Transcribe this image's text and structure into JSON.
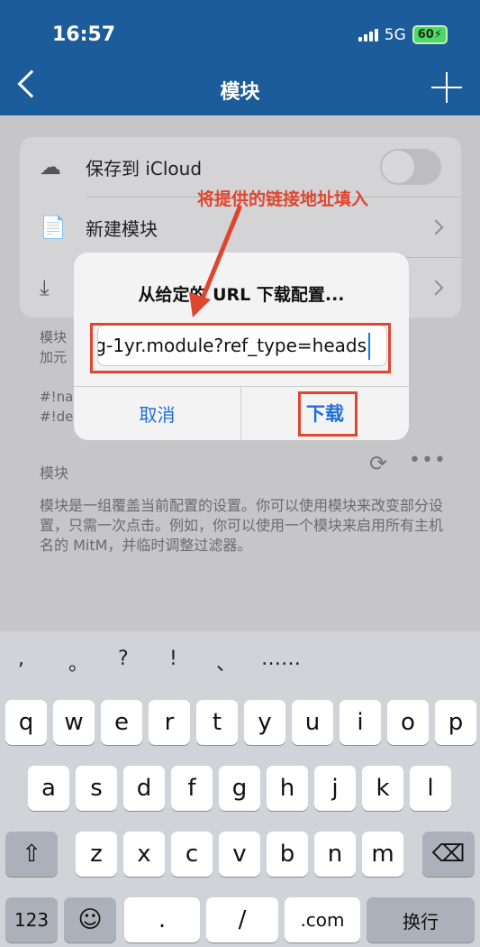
{
  "status_bar": {
    "time": "16:57",
    "network": "5G",
    "battery": "60"
  },
  "nav": {
    "title": "模块",
    "back_icon": "chevron-left-icon",
    "add_icon": "plus-icon"
  },
  "settings_rows": [
    {
      "icon": "☁",
      "label": "保存到 iCloud",
      "control": "toggle-off"
    },
    {
      "icon": "📄",
      "label": "新建模块",
      "control": "chevron"
    },
    {
      "icon": "⤓",
      "label": "",
      "control": "chevron"
    }
  ],
  "footer_text": [
    "模块",
    "加元",
    "#!na",
    "#!de"
  ],
  "section": {
    "label": "模块",
    "refresh_icon": "⟳",
    "more_icon": "•••"
  },
  "description": "模块是一组覆盖当前配置的设置。你可以使用模块来改变部分设置，只需一次点击。例如，你可以使用一个模块来启用所有主机名的 MitM，并临时调整过滤器。",
  "dialog": {
    "title": "从给定的 URL 下载配置...",
    "url_value": "g-1yr.module?ref_type=heads",
    "cancel": "取消",
    "download": "下载"
  },
  "annotation": {
    "text": "将提供的链接地址填入",
    "color": "#e0462f"
  },
  "keyboard": {
    "punctuation": [
      ",",
      "。",
      "?",
      "!",
      "、",
      "……"
    ],
    "row1": [
      "q",
      "w",
      "e",
      "r",
      "t",
      "y",
      "u",
      "i",
      "o",
      "p"
    ],
    "row2": [
      "a",
      "s",
      "d",
      "f",
      "g",
      "h",
      "j",
      "k",
      "l"
    ],
    "row3": [
      "z",
      "x",
      "c",
      "v",
      "b",
      "n",
      "m"
    ],
    "shift_icon": "⇧",
    "delete_icon": "⌫",
    "numbers_label": "123",
    "emoji_icon": "☺",
    "period": ".",
    "slash": "/",
    "dotcom": ".com",
    "return_label": "换行"
  },
  "colors": {
    "nav_bar": "#1d5c9a",
    "accent": "#1e6fd9",
    "annotation": "#e0462f"
  }
}
